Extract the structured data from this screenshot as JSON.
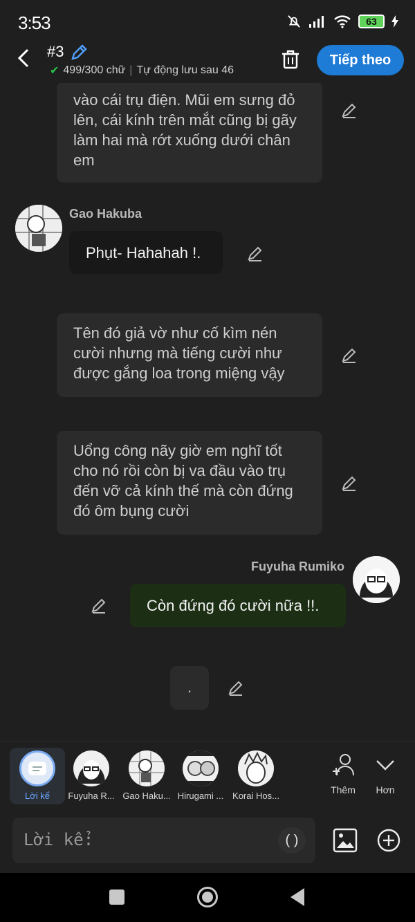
{
  "status": {
    "time": "3:53",
    "battery": "63"
  },
  "header": {
    "chapter_title": "#3",
    "word_count": "499/300 chữ",
    "autosave": "Tự động lưu sau 46",
    "next_label": "Tiếp theo"
  },
  "messages": [
    {
      "type": "narration",
      "text": "vào cái trụ điện. Mũi em sưng đỏ lên, cái kính trên mắt cũng bị gãy làm hai mà rớt xuống dưới chân em"
    },
    {
      "type": "character",
      "speaker": "Gao Hakuba",
      "text": "Phụt- Hahahah !."
    },
    {
      "type": "narration",
      "text": "Tên đó giả vờ như cố kìm nén cười nhưng mà tiếng cười như được gắng loa trong miệng vậy"
    },
    {
      "type": "narration",
      "text": "Uổng công nãy giờ em nghĩ tốt cho nó rồi còn bị va đầu vào trụ đến vỡ cả kính thế mà còn đứng đó ôm bụng cười"
    },
    {
      "type": "self",
      "speaker": "Fuyuha Rumiko",
      "text": "Còn đứng đó cười nữa !!."
    },
    {
      "type": "narration",
      "text": "."
    }
  ],
  "characters": [
    {
      "label": "Lời kể"
    },
    {
      "label": "Fuyuha R..."
    },
    {
      "label": "Gao Haku..."
    },
    {
      "label": "Hirugami ..."
    },
    {
      "label": "Korai Hos..."
    }
  ],
  "actions": {
    "add": "Thêm",
    "more": "Hơn"
  },
  "composer": {
    "placeholder": "Lời kể:",
    "paren": "( )"
  }
}
